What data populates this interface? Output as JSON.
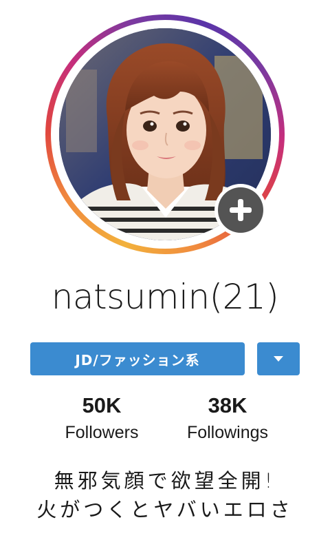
{
  "profile": {
    "avatar": {
      "icon": "profile-photo",
      "badge_icon": "plus-icon"
    },
    "username": "natsumin(21)",
    "category": "JD/ファッション系",
    "dropdown_icon": "chevron-down-icon",
    "stats": {
      "followers": {
        "value": "50K",
        "label": "Followers"
      },
      "followings": {
        "value": "38K",
        "label": "Followings"
      }
    },
    "bio": [
      "無邪気顔で欲望全開!",
      "火がつくとヤバいエロさ"
    ]
  },
  "colors": {
    "accent": "#3b8bd0",
    "badge": "#545454",
    "ring_start": "#f2b13c",
    "ring_mid": "#e0463f",
    "ring_end": "#5a34a8"
  }
}
